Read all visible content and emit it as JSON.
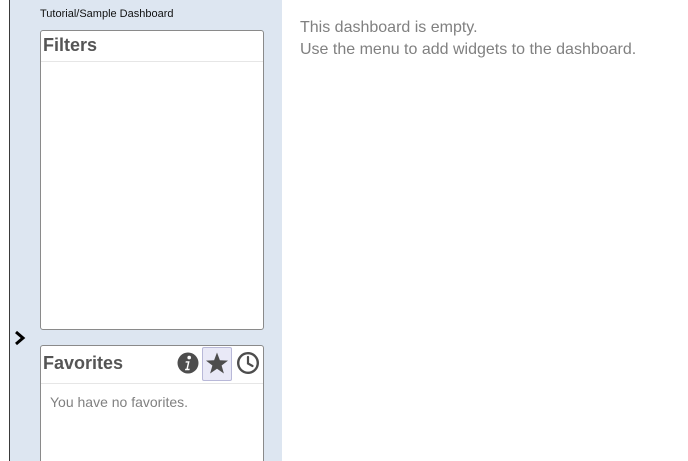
{
  "sidebar": {
    "breadcrumb": "Tutorial/Sample Dashboard",
    "filters": {
      "title": "Filters"
    },
    "favorites": {
      "title": "Favorites",
      "empty_text": "You have no favorites.",
      "actions": [
        {
          "icon": "info-icon"
        },
        {
          "icon": "star-icon",
          "selected": true
        },
        {
          "icon": "clock-icon"
        }
      ]
    },
    "collapse_toggle_icon": "chevron-right-icon"
  },
  "main": {
    "empty_line_1": "This dashboard is empty.",
    "empty_line_2": "Use the menu to add widgets to the dashboard."
  },
  "colors": {
    "sidebar_bg": "#dde6f1",
    "panel_border": "#8a8a8a",
    "muted_text": "#808080",
    "icon": "#4d4d4d",
    "selected_bg": "#e9e9f7"
  }
}
